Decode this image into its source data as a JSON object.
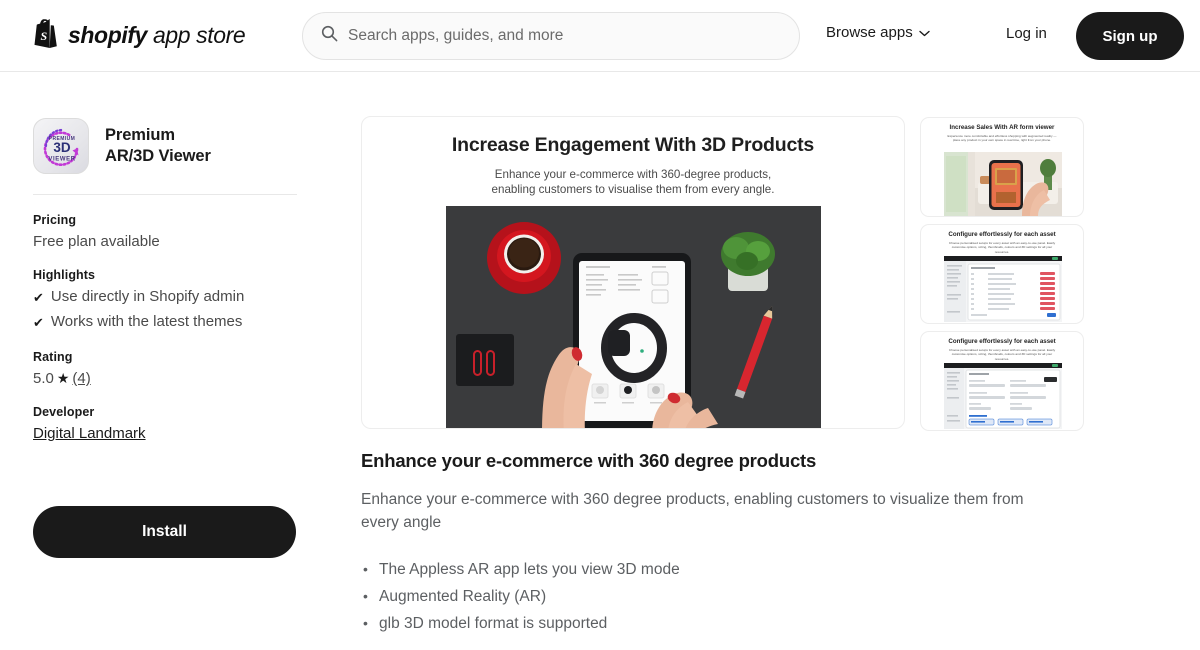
{
  "header": {
    "logo_text_bold": "shopify",
    "logo_text_light": "app store",
    "logo_icon": "shopify-bag-icon",
    "search": {
      "icon": "search-icon",
      "placeholder": "Search apps, guides, and more",
      "value": ""
    },
    "browse_apps_label": "Browse apps",
    "browse_apps_icon": "chevron-down-icon",
    "login_label": "Log in",
    "signup_label": "Sign up",
    "signup_bg": "#1a1a1a"
  },
  "app": {
    "icon": {
      "name": "premium-3d-viewer-app-icon",
      "top_text": "PREMIUM",
      "main_text": "3D",
      "bottom_text": "VIEWER",
      "accent": "#b93fd6"
    },
    "title_line1": "Premium",
    "title_line2": "AR/3D Viewer",
    "pricing": {
      "label": "Pricing",
      "value": "Free plan available"
    },
    "highlights": {
      "label": "Highlights",
      "items": [
        "Use directly in Shopify admin",
        "Works with the latest themes"
      ],
      "check_glyph": "✔"
    },
    "rating": {
      "label": "Rating",
      "score": "5.0",
      "star_glyph": "★",
      "count": "(4)"
    },
    "developer": {
      "label": "Developer",
      "name": "Digital Landmark"
    },
    "install_label": "Install"
  },
  "hero": {
    "title": "Increase Engagement With 3D Products",
    "subtitle_line1": "Enhance your e-commerce with 360-degree products,",
    "subtitle_line2": "enabling customers to visualise them from every angle.",
    "photo_alt": "hands-holding-tablet-photo"
  },
  "thumbnails": [
    {
      "title": "Increase Sales With AR form viewer",
      "subtitle": "Experience more comfortable and effortless shopping with augmented reality — place any product in your own space in real time, right from your phone.",
      "image": "ar-phone-living-room-photo"
    },
    {
      "title": "Configure effortlessly for each asset",
      "subtitle": "Choose personalised setups for every asset with an easy-to-use panel. Easily customise options, sizing, thumbnails, colours and 3D settings for all your resources.",
      "image": "admin-asset-list-screenshot"
    },
    {
      "title": "Configure effortlessly for each asset",
      "subtitle": "Choose personalised setups for every asset with an easy-to-use panel. Easily customise options, sizing, thumbnails, colours and 3D settings for all your resources.",
      "image": "admin-asset-detail-screenshot"
    }
  ],
  "content": {
    "heading": "Enhance your e-commerce with 360 degree products",
    "paragraph": "Enhance your e-commerce with 360 degree products, enabling customers to visualize them from every angle",
    "bullets": [
      "The Appless AR app lets you view 3D mode",
      "Augmented Reality (AR)",
      "glb 3D model format is supported"
    ]
  }
}
